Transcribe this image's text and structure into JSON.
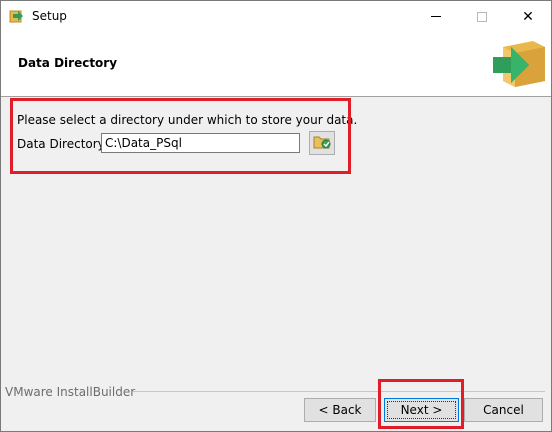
{
  "window": {
    "title": "Setup",
    "icon": "setup-installer-icon"
  },
  "titlebar_controls": {
    "minimize": "minimize-icon",
    "maximize": "maximize-icon",
    "close": "close-icon",
    "close_glyph": "✕"
  },
  "header": {
    "title": "Data Directory",
    "logo": "installer-box-arrow-logo"
  },
  "content": {
    "prompt": "Please select a directory under which to store your data.",
    "dir_label": "Data Directory",
    "dir_value": "C:\\Data_PSql",
    "browse_icon": "folder-browse-icon"
  },
  "footer": {
    "brand": "VMware InstallBuilder",
    "back_label": "< Back",
    "next_label": "Next >",
    "cancel_label": "Cancel"
  },
  "colors": {
    "highlight": "#e11d2a",
    "accent": "#0078d7",
    "logo_green": "#2f9e5b",
    "logo_box": "#e8b84a"
  }
}
